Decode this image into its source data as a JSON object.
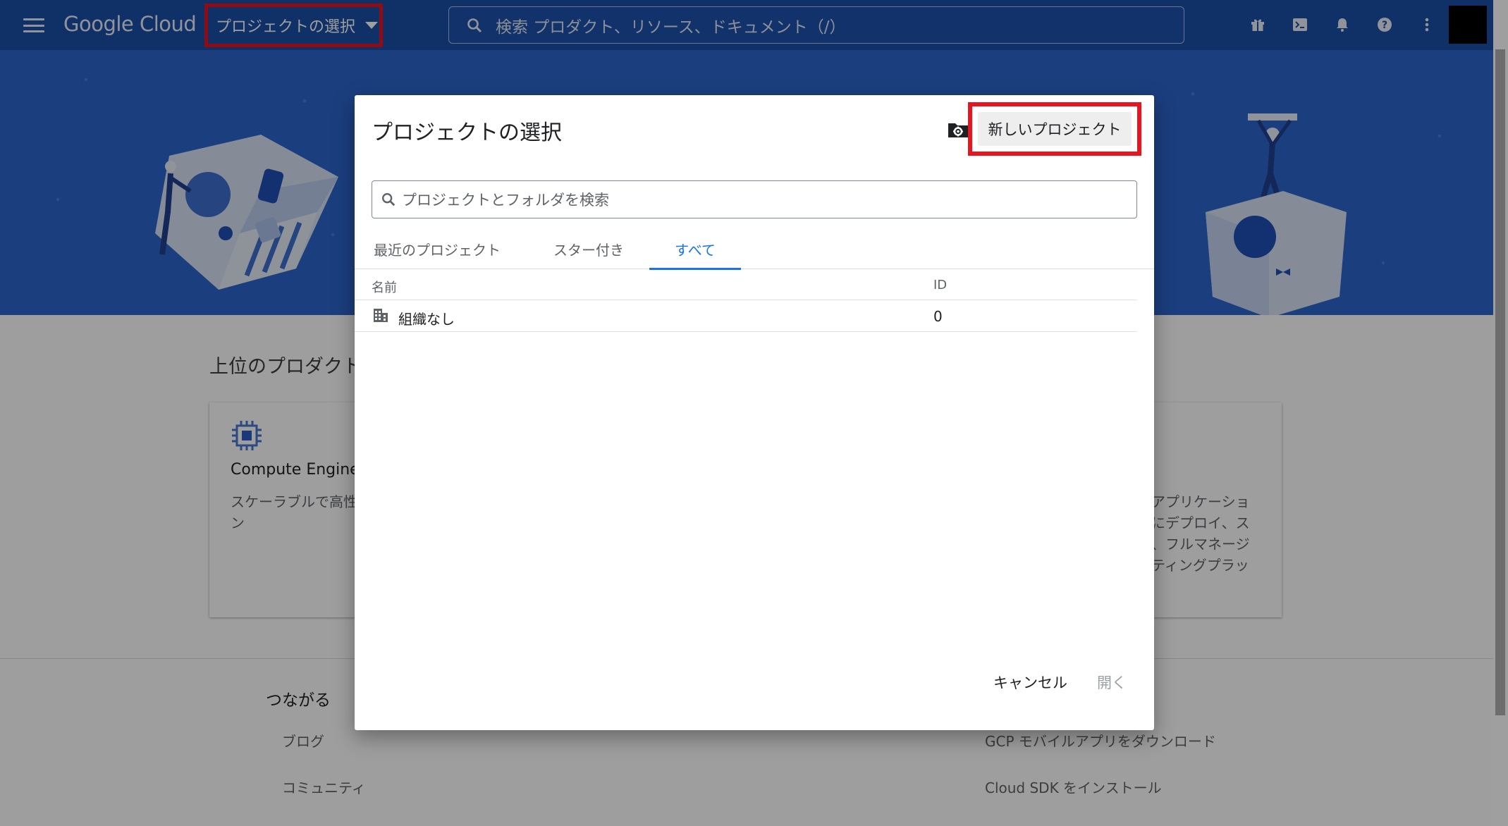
{
  "app": {
    "brand": "Google Cloud",
    "project_selector_label": "プロジェクトの選択",
    "search_placeholder": "検索  プロダクト、リソース、ドキュメント（/）"
  },
  "topbar_icons": [
    "gift-icon",
    "cloud-shell-icon",
    "notifications-icon",
    "help-icon",
    "more-vert-icon"
  ],
  "page": {
    "section_title": "上位のプロダクト",
    "cards": [
      {
        "title": "Compute Engine",
        "desc": "スケーラブルで高性\nン"
      },
      {
        "title": "",
        "desc": "アプリケーショ\nにデプロイ、ス\n、フルマネージ\nティングプラッ"
      }
    ],
    "footer": {
      "heading": "つながる",
      "links_left": [
        "ブログ",
        "コミュニティ"
      ],
      "links_right": [
        "GCP モバイルアプリをダウンロード",
        "Cloud SDK をインストール"
      ]
    }
  },
  "dialog": {
    "title": "プロジェクトの選択",
    "new_project_label": "新しいプロジェクト",
    "search_placeholder": "プロジェクトとフォルダを検索",
    "tabs": [
      {
        "label": "最近のプロジェクト",
        "active": false
      },
      {
        "label": "スター付き",
        "active": false
      },
      {
        "label": "すべて",
        "active": true
      }
    ],
    "table": {
      "columns": [
        "名前",
        "ID"
      ],
      "rows": [
        {
          "name": "組織なし",
          "id": "0"
        }
      ]
    },
    "cancel_label": "キャンセル",
    "open_label": "開く"
  },
  "colors": {
    "topbar": "#1a4fa8",
    "hero": "#2c64cc",
    "highlight": "#e8141e",
    "accent": "#1a73e8"
  }
}
